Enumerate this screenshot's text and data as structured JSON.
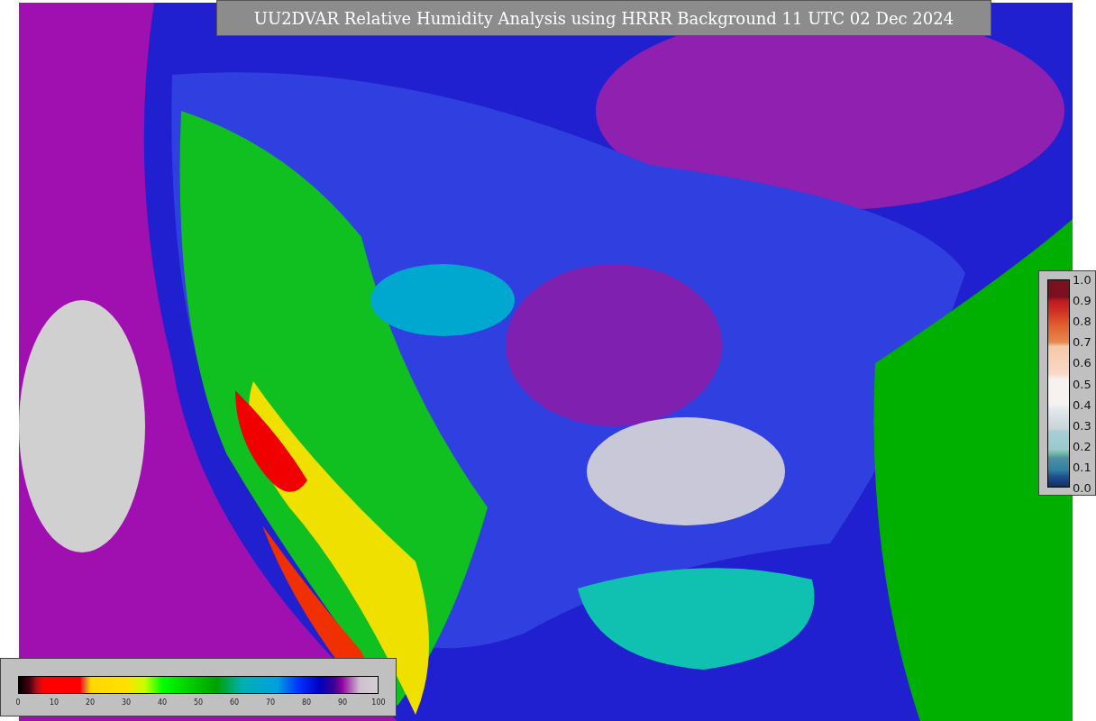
{
  "title": "UU2DVAR Relative Humidity Analysis using HRRR Background 11 UTC 02 Dec 2024",
  "humidity_scale": {
    "ticks": [
      "0",
      "10",
      "20",
      "30",
      "40",
      "50",
      "60",
      "70",
      "80",
      "90",
      "100"
    ]
  },
  "weight_scale": {
    "ticks": [
      "1.0",
      "0.9",
      "0.8",
      "0.7",
      "0.6",
      "0.5",
      "0.4",
      "0.3",
      "0.2",
      "0.1",
      "0.0"
    ]
  }
}
